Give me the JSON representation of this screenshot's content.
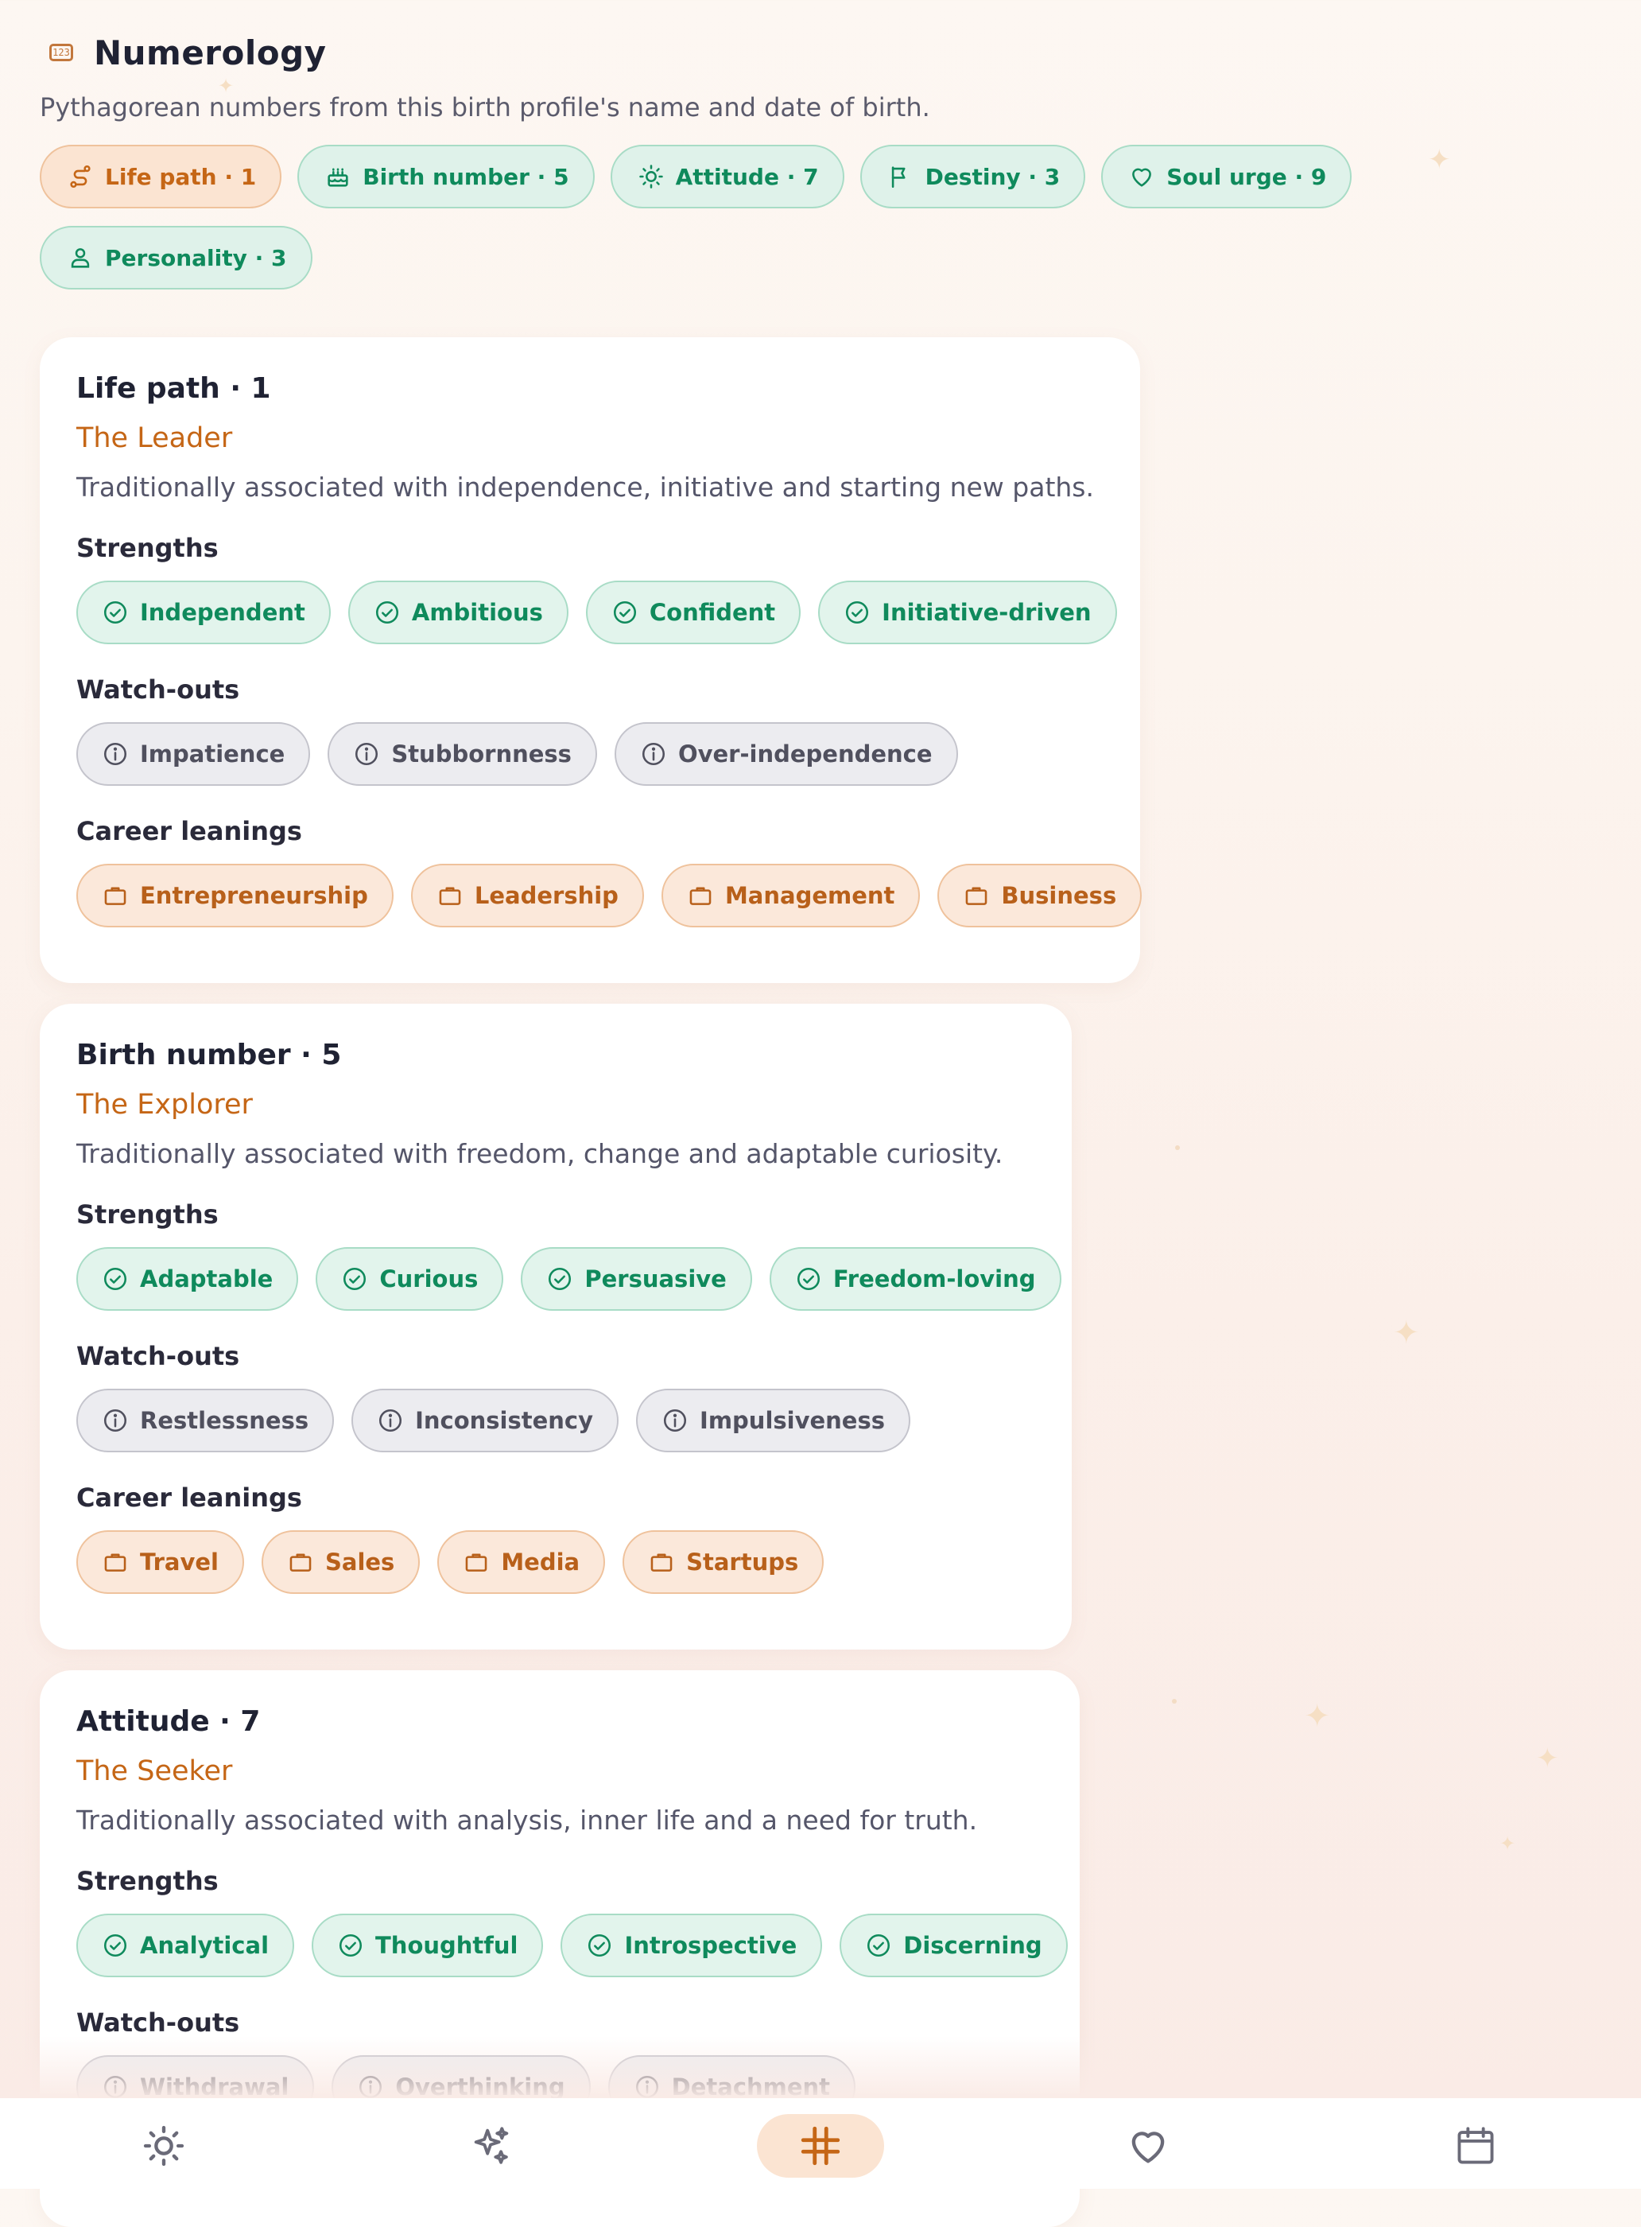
{
  "header": {
    "title": "Numerology",
    "icon": "numbers-icon",
    "icon_text": "123"
  },
  "subtitle": "Pythagorean numbers from this birth profile's name and date of birth.",
  "tabs": [
    {
      "label": "Life path · 1",
      "icon": "path-icon",
      "active": true
    },
    {
      "label": "Birth number · 5",
      "icon": "cake-icon",
      "active": false
    },
    {
      "label": "Attitude · 7",
      "icon": "sun-icon",
      "active": false
    },
    {
      "label": "Destiny · 3",
      "icon": "flag-icon",
      "active": false
    },
    {
      "label": "Soul urge · 9",
      "icon": "heart-icon",
      "active": false
    },
    {
      "label": "Personality · 3",
      "icon": "person-icon",
      "active": false
    }
  ],
  "labels": {
    "strengths": "Strengths",
    "watchouts": "Watch-outs",
    "careers": "Career leanings"
  },
  "cards": [
    {
      "title": "Life path · 1",
      "archetype": "The Leader",
      "description": "Traditionally associated with independence, initiative and starting new paths.",
      "strengths": [
        "Independent",
        "Ambitious",
        "Confident",
        "Initiative-driven"
      ],
      "watchouts": [
        "Impatience",
        "Stubbornness",
        "Over-independence"
      ],
      "careers": [
        "Entrepreneurship",
        "Leadership",
        "Management",
        "Business"
      ]
    },
    {
      "title": "Birth number · 5",
      "archetype": "The Explorer",
      "description": "Traditionally associated with freedom, change and adaptable curiosity.",
      "strengths": [
        "Adaptable",
        "Curious",
        "Persuasive",
        "Freedom-loving"
      ],
      "watchouts": [
        "Restlessness",
        "Inconsistency",
        "Impulsiveness"
      ],
      "careers": [
        "Travel",
        "Sales",
        "Media",
        "Startups"
      ]
    },
    {
      "title": "Attitude · 7",
      "archetype": "The Seeker",
      "description": "Traditionally associated with analysis, inner life and a need for truth.",
      "strengths": [
        "Analytical",
        "Thoughtful",
        "Introspective",
        "Discerning"
      ],
      "watchouts": [
        "Withdrawal",
        "Overthinking",
        "Detachment"
      ],
      "careers": []
    }
  ],
  "nav": [
    {
      "name": "sun-icon",
      "active": false
    },
    {
      "name": "sparkles-icon",
      "active": false
    },
    {
      "name": "grid-icon",
      "active": true
    },
    {
      "name": "heart-icon",
      "active": false
    },
    {
      "name": "calendar-icon",
      "active": false
    }
  ],
  "colors": {
    "accent": "#c56616",
    "strength": "#0f8a5c",
    "watchout": "#50505e",
    "career": "#b8601a"
  }
}
